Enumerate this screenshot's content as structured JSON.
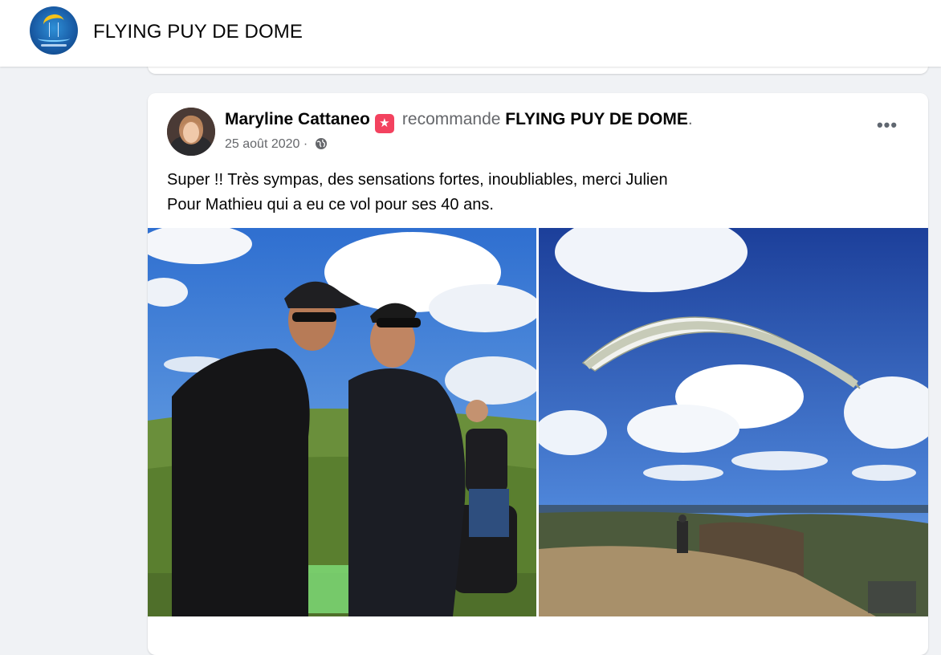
{
  "header": {
    "page_name": "FLYING PUY DE DOME",
    "logo_icon": "paraglider-logo-icon"
  },
  "post": {
    "author": "Maryline Cattaneo",
    "badge_icon": "recommend-badge-icon",
    "verb": "recommande",
    "target": "FLYING PUY DE DOME",
    "target_suffix": ".",
    "date": "25 août 2020",
    "privacy_sep": " · ",
    "privacy_icon": "globe-icon",
    "more_label": "•••",
    "text_lines": [
      "Super !! Très sympas, des sensations fortes, inoubliables, merci Julien",
      "Pour Mathieu qui a eu ce vol pour ses 40 ans."
    ],
    "photos": [
      {
        "icon": "photo-paragliding-instructors"
      },
      {
        "icon": "photo-paraglider-flying"
      }
    ]
  },
  "colors": {
    "background": "#f0f2f5",
    "card": "#ffffff",
    "text_primary": "#050505",
    "text_secondary": "#65676b",
    "badge": "#f3425f"
  }
}
